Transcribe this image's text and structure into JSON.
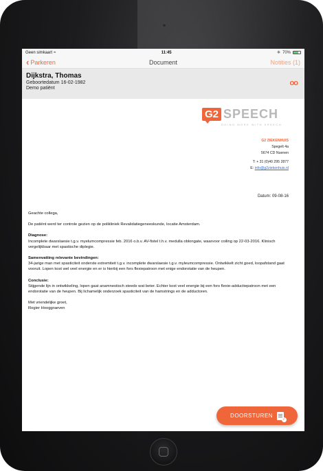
{
  "statusbar": {
    "carrier": "Geen simkaart",
    "time": "11:45",
    "battery_pct": "70%",
    "battery_level": 0.7
  },
  "navbar": {
    "back_label": "Parkeren",
    "title": "Document",
    "notifications_label": "Notities (1)"
  },
  "patient": {
    "name": "Dijkstra, Thomas",
    "dob": "Geboortedatum 16-02-1982",
    "note": "Demo patiënt"
  },
  "letterhead": {
    "logo_badge": "G2",
    "logo_word": "SPEECH",
    "logo_tagline": "DOING MORE WITH SPEECH",
    "org": "G2 ZIEKENHUIS",
    "street": "Spegelt 4a",
    "city": "5674 CD Nuenen",
    "phone": "T: + 31 (0)40 295 2877",
    "email_prefix": "E: ",
    "email": "info@g2ziekenhuis.nl"
  },
  "letter": {
    "date": "Datum: 09-08-16",
    "salutation": "Geachte collega,",
    "intro": "De patiënt werd ter controle gezien op de polikliniek Revalidatiegeneeskunde, locatie Amsterdam.",
    "diagnose_heading": "Diagnose:",
    "diagnose_text": "Incomplete dwarslaesie t.g.v. myelumcompressie feb. 2016 o.b.v. AV-fistel t.h.v. medulla oblongate, waarvoor coiling op 22-03-2016. Klinisch vergelijkbaar met spastische diplegie.",
    "bevindingen_heading": "Samenvatting relevante bevindingen:",
    "bevindingen_text": "34-jarige man met spasticiteit onderste extremiteit t.g.v. incomplete dwarslaesie t.g.v. myleumcompressie. Ontwikkelt zicht goed, loopafstand gaat vooruit. Lopen kost wel veel energie en er is hierbij een fors flexiepatroon met enige endorotatie van de heupen.",
    "conclusie_heading": "Conclusie:",
    "conclusie_text": "Stijgende lijn in ontwikkeling, lopen gaat anamnestisch steeds wat beter. Echter kost veel energie bij een fors flexie-adductiepatroon met een endorotatie van de heupen. Bij lichamelijk onderzoek spasticiteit van de hamstrings en de adductoren.",
    "closing": "Met vriendelijke groet,",
    "signature": "Rogier Hooggraeven"
  },
  "actions": {
    "forward_label": "DOORSTUREN"
  },
  "colors": {
    "accent": "#f0663b",
    "header_bg": "#e9e9e9"
  }
}
